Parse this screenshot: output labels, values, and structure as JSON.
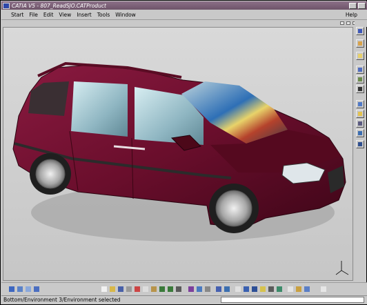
{
  "window": {
    "title": "CATIA V5 - 807_ReadSJO.CATProduct"
  },
  "menu": {
    "items": [
      "Start",
      "File",
      "Edit",
      "View",
      "Insert",
      "Tools",
      "Window"
    ],
    "help": "Help"
  },
  "status": {
    "message": "Bottom/Environment 3/Environment selected"
  },
  "colors": {
    "title_bar": "#7d6178",
    "chrome": "#c9c9c9",
    "car_body": "#6a0e2c",
    "viewport_bg": "#d2d2d2"
  },
  "icons": {
    "right_toolbar": [
      "product-structure-icon",
      "select-icon",
      "compass-icon",
      "scene-editor-icon",
      "environment-icon",
      "camera-icon",
      "turntable-icon",
      "light-icon",
      "shadow-icon",
      "ambience-icon",
      "render-icon"
    ],
    "bottom_toolbar": [
      "pan-icon",
      "rotate-icon",
      "zoom-icon",
      "fly-icon",
      "new-icon",
      "open-icon",
      "save-icon",
      "print-icon",
      "cut-icon",
      "copy-icon",
      "paste-icon",
      "undo-icon",
      "redo-icon",
      "whats-this-icon",
      "fit-all-icon",
      "normal-view-icon",
      "multi-view-icon",
      "iso-view-icon",
      "shading-icon",
      "wireframe-icon",
      "hide-show-icon",
      "swap-visible-icon",
      "measure-icon",
      "catalog-icon",
      "apply-material-icon",
      "analysis-icon",
      "search-icon",
      "help-icon"
    ]
  }
}
